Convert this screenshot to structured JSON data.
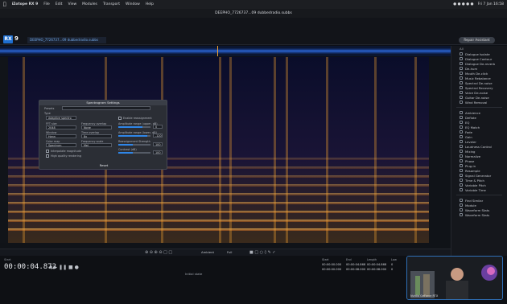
{
  "menubar": {
    "app_name": "iZotope RX 9",
    "items": [
      "File",
      "Edit",
      "View",
      "Modules",
      "Transport",
      "Window",
      "Help"
    ],
    "clock": "Fri 7 Jan 16:58"
  },
  "window": {
    "title": "DEEPHO_7726737...09 dubbedradio.subbs"
  },
  "toolbar": {
    "logo": "RX",
    "logo_sub": "9",
    "file_tab": "DEEPHO_7726737...09 dubbedradio.subbs",
    "ip_button": "Repair Assistant"
  },
  "dialog": {
    "title": "Spectrogram Settings",
    "preset_label": "Presets",
    "preset_value": "",
    "type_label": "Type",
    "type_value": "Adaptive spectro",
    "enable_label": "Enable reassignment",
    "fft_label": "FFT size",
    "fft_value": "2048",
    "freq_overlap_label": "Frequency overlap",
    "freq_overlap_value": "None",
    "amp_label": "Amplitude range (upper, dB)",
    "amp_value": "0",
    "window_label": "Window",
    "window_value": "Hann",
    "time_overlap_label": "Time overlap",
    "time_overlap_value": "8x",
    "amp_lower_label": "Amplitude range (lower, dB)",
    "amp_lower_value": "-120",
    "color_label": "Color map",
    "color_value": "Spectrum",
    "freq_scale_label": "Frequency scale",
    "freq_scale_value": "Mel",
    "reassign_label": "Reassignment Strength",
    "reassign_value": "100",
    "contrast_label": "Contrast (dB)",
    "contrast_value": "100",
    "interp_label": "Interpolate magnitude",
    "hq_label": "High quality rendering",
    "reset_label": "Reset"
  },
  "sidebar": {
    "filter_label": "All",
    "repair": [
      "Dialogue Isolate",
      "Dialogue Contour",
      "Dialogue De-reverb",
      "De-hum",
      "Mouth De-click",
      "Music Rebalance",
      "Spectral De-noise",
      "Spectral Recovery",
      "Voice De-noise",
      "Guitar De-noise",
      "Wind Removal"
    ],
    "utility": [
      "Ambience",
      "Deflate",
      "EQ",
      "EQ Match",
      "Fade",
      "Gain",
      "Leveler",
      "Loudness Control",
      "Mixing",
      "Normalize",
      "Phase",
      "Plug-in",
      "Resample",
      "Signal Generator",
      "Time & Pitch",
      "Variable Pitch",
      "Variable Time"
    ],
    "bottom": [
      "Find Similar",
      "Module",
      "Waveform Stats",
      "Waveform Stats"
    ]
  },
  "timecode": {
    "label": "Start",
    "value": "00:00:04.872"
  },
  "selection_table": {
    "headers": [
      "Start",
      "End",
      "Length",
      "Low"
    ],
    "sel": [
      "00:00:00.000",
      "00:00:04.868",
      "00:00:04.868",
      "0"
    ],
    "view": [
      "00:00:00.000",
      "00:00:08.000",
      "00:00:08.000",
      "0"
    ]
  },
  "history_label": "Initial state",
  "spectrogram_bar": {
    "mode": "Ambient",
    "zoom": "Full"
  },
  "video": {
    "caption": "Nvidia GeForce RTX"
  },
  "colors": {
    "accent": "#2f86e8",
    "spectrum_hot": "#f0a030",
    "background": "#0a0f2a"
  }
}
